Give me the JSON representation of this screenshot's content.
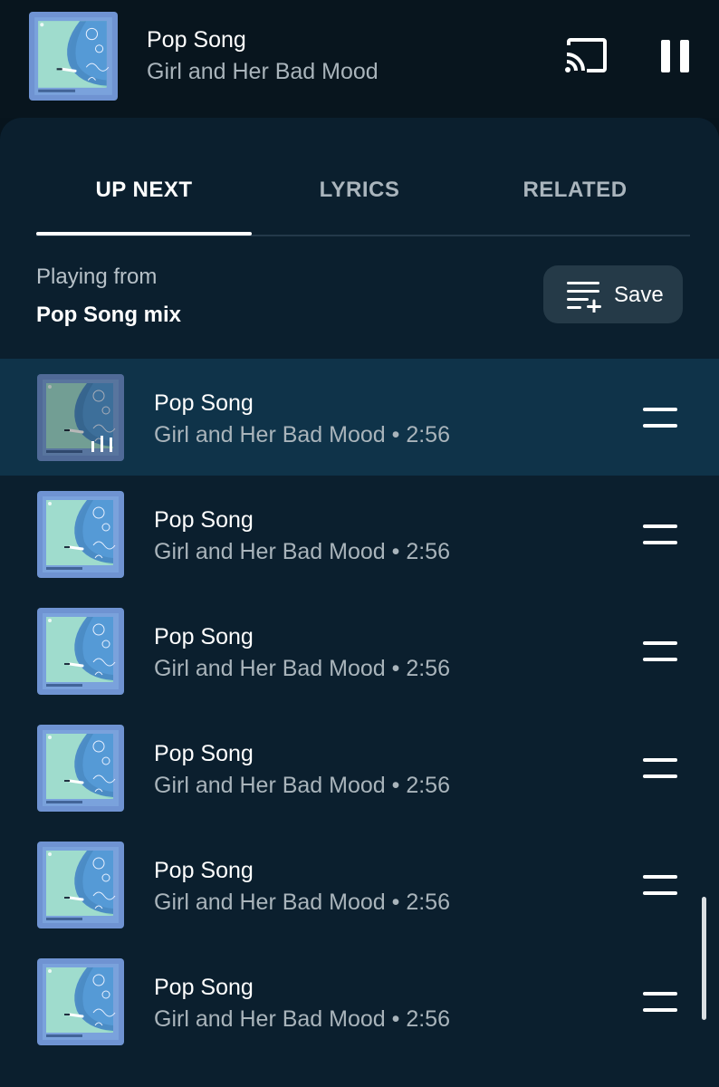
{
  "mini_player": {
    "title": "Pop Song",
    "artist": "Girl and Her Bad Mood",
    "cast_icon": "cast-icon",
    "pause_icon": "pause-icon"
  },
  "tabs": [
    {
      "label": "UP NEXT",
      "active": true
    },
    {
      "label": "LYRICS",
      "active": false
    },
    {
      "label": "RELATED",
      "active": false
    }
  ],
  "playing_from": {
    "label": "Playing from",
    "value": "Pop Song mix"
  },
  "save_button": {
    "label": "Save",
    "icon": "playlist-add-icon"
  },
  "queue": [
    {
      "title": "Pop Song",
      "subtitle": "Girl and Her Bad Mood • 2:56",
      "now_playing": true
    },
    {
      "title": "Pop Song",
      "subtitle": "Girl and Her Bad Mood • 2:56",
      "now_playing": false
    },
    {
      "title": "Pop Song",
      "subtitle": "Girl and Her Bad Mood • 2:56",
      "now_playing": false
    },
    {
      "title": "Pop Song",
      "subtitle": "Girl and Her Bad Mood • 2:56",
      "now_playing": false
    },
    {
      "title": "Pop Song",
      "subtitle": "Girl and Her Bad Mood • 2:56",
      "now_playing": false
    },
    {
      "title": "Pop Song",
      "subtitle": "Girl and Her Bad Mood • 2:56",
      "now_playing": false
    }
  ],
  "colors": {
    "background": "#07141d",
    "sheet": "#0b1f2e",
    "current_row": "#0f3349",
    "art_blue": "#6f93d2",
    "art_teal": "#8ed0c0"
  }
}
